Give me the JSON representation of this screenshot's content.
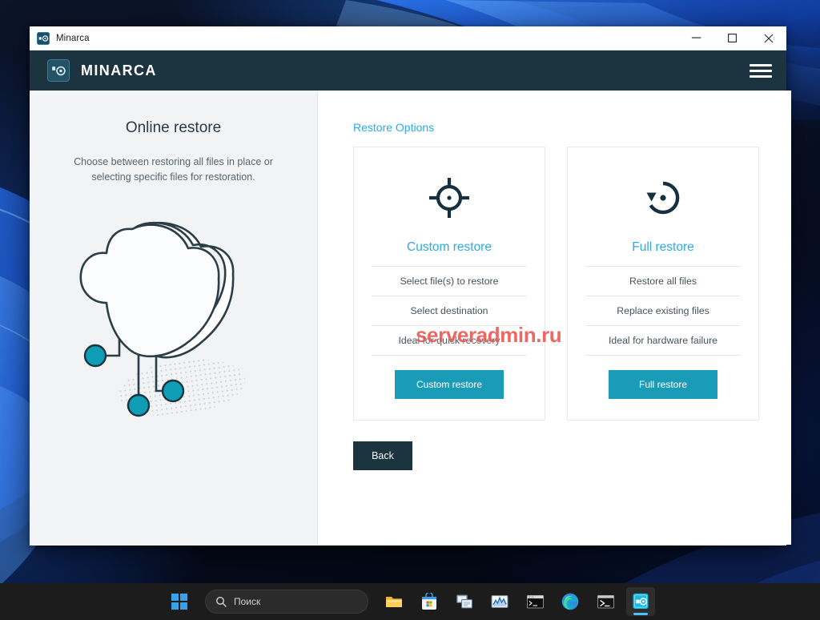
{
  "window": {
    "title": "Minarca",
    "icon": "minarca-app-icon",
    "controls": {
      "minimize": "─",
      "maximize": "☐",
      "close": "✕"
    }
  },
  "appbar": {
    "brand": "MINARCA",
    "logo_icon": "minarca-logo-icon",
    "menu_icon": "hamburger-menu-icon"
  },
  "left_panel": {
    "title": "Online restore",
    "description": "Choose between restoring all files in place or selecting specific files for restoration.",
    "illustration": "cloud-network-illustration"
  },
  "right_panel": {
    "section_title": "Restore Options",
    "cards": [
      {
        "icon": "crosshair-target-icon",
        "title": "Custom restore",
        "features": [
          "Select file(s) to restore",
          "Select destination",
          "Ideal for quick recovery"
        ],
        "button": "Custom restore"
      },
      {
        "icon": "restore-backup-icon",
        "title": "Full restore",
        "features": [
          "Restore all files",
          "Replace existing files",
          "Ideal for hardware failure"
        ],
        "button": "Full restore"
      }
    ],
    "back_button": "Back"
  },
  "watermark": "serveradmin.ru",
  "taskbar": {
    "start_icon": "windows-start-icon",
    "search": {
      "icon": "search-icon",
      "placeholder": "Поиск",
      "value": ""
    },
    "items": [
      {
        "icon": "file-explorer-icon",
        "label": "File Explorer",
        "active": false
      },
      {
        "icon": "microsoft-store-icon",
        "label": "Microsoft Store",
        "active": false
      },
      {
        "icon": "remote-desktop-icon",
        "label": "Remote Desktop",
        "active": false
      },
      {
        "icon": "performance-monitor-icon",
        "label": "Performance Monitor",
        "active": false
      },
      {
        "icon": "command-prompt-icon",
        "label": "Command Prompt",
        "active": false
      },
      {
        "icon": "microsoft-edge-icon",
        "label": "Microsoft Edge",
        "active": false
      },
      {
        "icon": "powershell-icon",
        "label": "Windows PowerShell",
        "active": false
      },
      {
        "icon": "minarca-taskbar-icon",
        "label": "Minarca",
        "active": true
      }
    ]
  },
  "colors": {
    "accent_teal": "#29ace2",
    "button_teal": "#1a9cb8",
    "header_dark": "#1b3440",
    "watermark_red": "#e83e36",
    "panel_gray": "#f1f3f5"
  }
}
